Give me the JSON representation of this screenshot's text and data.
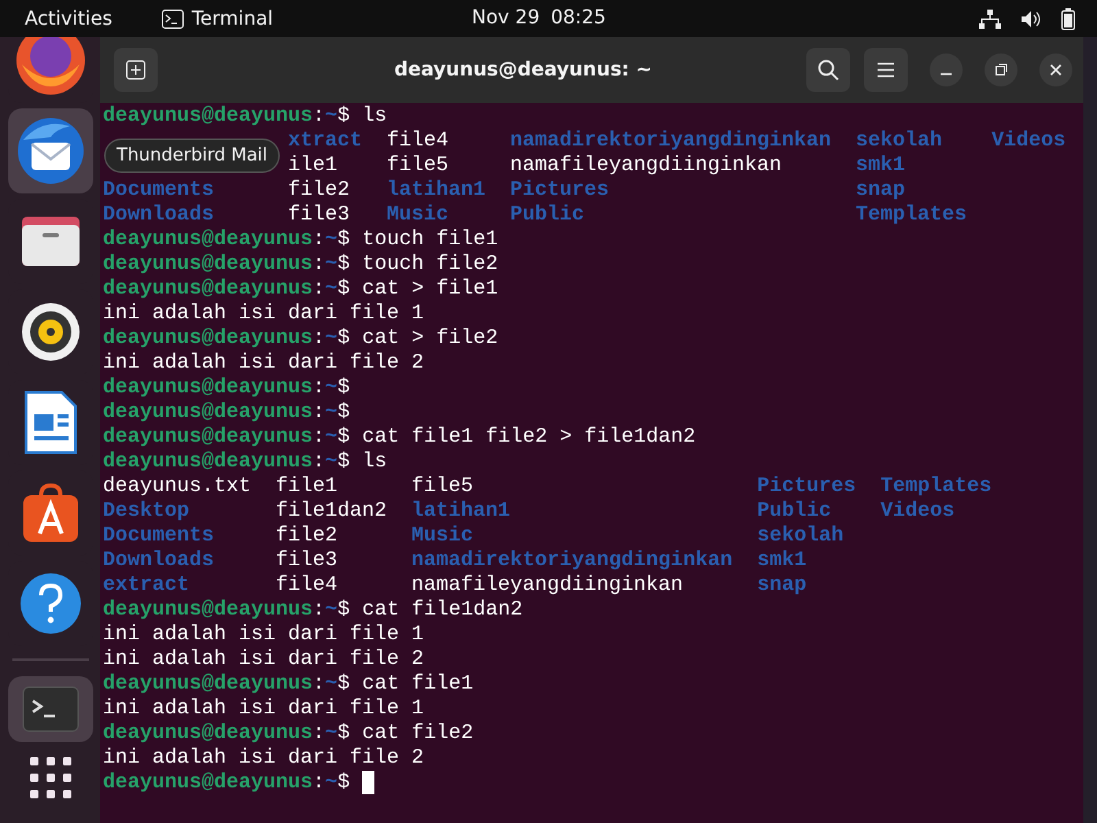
{
  "top_bar": {
    "activities": "Activities",
    "app_name": "Terminal",
    "date": "Nov 29",
    "time": "08:25"
  },
  "dock": {
    "pinned": [
      {
        "kind": "browser",
        "highlighted": false
      },
      {
        "kind": "mail",
        "highlighted": true
      },
      {
        "kind": "files",
        "highlighted": false
      },
      {
        "kind": "music",
        "highlighted": false
      },
      {
        "kind": "document",
        "highlighted": false
      },
      {
        "kind": "store",
        "highlighted": false
      },
      {
        "kind": "help",
        "highlighted": false
      }
    ],
    "running": [
      {
        "kind": "terminal",
        "highlighted": true
      }
    ],
    "tooltip": "Thunderbird Mail"
  },
  "window": {
    "title": "deayunus@deayunus: ~"
  },
  "terminal": {
    "lines": [
      {
        "kind": "prompt",
        "user": "deayunus@deayunus",
        "colon": ":",
        "path": "~",
        "sign": "$",
        "command": "ls"
      },
      {
        "kind": "listing",
        "rows": [
          [
            {
              "kind": "covered"
            },
            {
              "kind": "dir",
              "text": "xtract"
            },
            {
              "kind": "file",
              "text": "file4"
            },
            {
              "kind": "dir",
              "text": "namadirektoriyangdinginkan"
            },
            {
              "kind": "dir",
              "text": "sekolah"
            },
            {
              "kind": "dir",
              "text": "Videos"
            }
          ],
          [
            {
              "kind": "covered"
            },
            {
              "kind": "file",
              "text": "ile1"
            },
            {
              "kind": "file",
              "text": "file5"
            },
            {
              "kind": "file",
              "text": "namafileyangdiinginkan"
            },
            {
              "kind": "dir",
              "text": "smk1"
            }
          ],
          [
            {
              "kind": "dir",
              "text": "Documents"
            },
            {
              "kind": "file",
              "text": "file2"
            },
            {
              "kind": "dir",
              "text": "latihan1"
            },
            {
              "kind": "dir",
              "text": "Pictures"
            },
            {
              "kind": "dir",
              "text": "snap"
            }
          ],
          [
            {
              "kind": "dir",
              "text": "Downloads"
            },
            {
              "kind": "file",
              "text": "file3"
            },
            {
              "kind": "dir",
              "text": "Music"
            },
            {
              "kind": "dir",
              "text": "Public"
            },
            {
              "kind": "dir",
              "text": "Templates"
            }
          ]
        ]
      },
      {
        "kind": "prompt",
        "user": "deayunus@deayunus",
        "colon": ":",
        "path": "~",
        "sign": "$",
        "command": "touch file1"
      },
      {
        "kind": "prompt",
        "user": "deayunus@deayunus",
        "colon": ":",
        "path": "~",
        "sign": "$",
        "command": "touch file2"
      },
      {
        "kind": "prompt",
        "user": "deayunus@deayunus",
        "colon": ":",
        "path": "~",
        "sign": "$",
        "command": "cat > file1"
      },
      {
        "kind": "output",
        "text": "ini adalah isi dari file 1"
      },
      {
        "kind": "prompt",
        "user": "deayunus@deayunus",
        "colon": ":",
        "path": "~",
        "sign": "$",
        "command": "cat > file2"
      },
      {
        "kind": "output",
        "text": "ini adalah isi dari file 2"
      },
      {
        "kind": "prompt",
        "user": "deayunus@deayunus",
        "colon": ":",
        "path": "~",
        "sign": "$"
      },
      {
        "kind": "prompt",
        "user": "deayunus@deayunus",
        "colon": ":",
        "path": "~",
        "sign": "$"
      },
      {
        "kind": "prompt",
        "user": "deayunus@deayunus",
        "colon": ":",
        "path": "~",
        "sign": "$",
        "command": "cat file1 file2 > file1dan2"
      },
      {
        "kind": "prompt",
        "user": "deayunus@deayunus",
        "colon": ":",
        "path": "~",
        "sign": "$",
        "command": "ls"
      },
      {
        "kind": "listing",
        "rows": [
          [
            {
              "kind": "file",
              "text": "deayunus.txt"
            },
            {
              "kind": "file",
              "text": "file1"
            },
            {
              "kind": "file",
              "text": "file5"
            },
            {
              "kind": "dir",
              "text": "Pictures"
            },
            {
              "kind": "dir",
              "text": "Templates"
            }
          ],
          [
            {
              "kind": "dir",
              "text": "Desktop"
            },
            {
              "kind": "file",
              "text": "file1dan2"
            },
            {
              "kind": "dir",
              "text": "latihan1"
            },
            {
              "kind": "dir",
              "text": "Public"
            },
            {
              "kind": "dir",
              "text": "Videos"
            }
          ],
          [
            {
              "kind": "dir",
              "text": "Documents"
            },
            {
              "kind": "file",
              "text": "file2"
            },
            {
              "kind": "dir",
              "text": "Music"
            },
            {
              "kind": "dir",
              "text": "sekolah"
            }
          ],
          [
            {
              "kind": "dir",
              "text": "Downloads"
            },
            {
              "kind": "file",
              "text": "file3"
            },
            {
              "kind": "dir",
              "text": "namadirektoriyangdinginkan"
            },
            {
              "kind": "dir",
              "text": "smk1"
            }
          ],
          [
            {
              "kind": "dir",
              "text": "extract"
            },
            {
              "kind": "file",
              "text": "file4"
            },
            {
              "kind": "file",
              "text": "namafileyangdiinginkan"
            },
            {
              "kind": "dir",
              "text": "snap"
            }
          ]
        ]
      },
      {
        "kind": "prompt",
        "user": "deayunus@deayunus",
        "colon": ":",
        "path": "~",
        "sign": "$",
        "command": "cat file1dan2"
      },
      {
        "kind": "output",
        "text": "ini adalah isi dari file 1"
      },
      {
        "kind": "output",
        "text": "ini adalah isi dari file 2"
      },
      {
        "kind": "prompt",
        "user": "deayunus@deayunus",
        "colon": ":",
        "path": "~",
        "sign": "$",
        "command": "cat file1"
      },
      {
        "kind": "output",
        "text": "ini adalah isi dari file 1"
      },
      {
        "kind": "prompt",
        "user": "deayunus@deayunus",
        "colon": ":",
        "path": "~",
        "sign": "$",
        "command": "cat file2"
      },
      {
        "kind": "output",
        "text": "ini adalah isi dari file 2"
      },
      {
        "kind": "prompt",
        "user": "deayunus@deayunus",
        "colon": ":",
        "path": "~",
        "sign": "$",
        "cursor": true
      }
    ]
  }
}
